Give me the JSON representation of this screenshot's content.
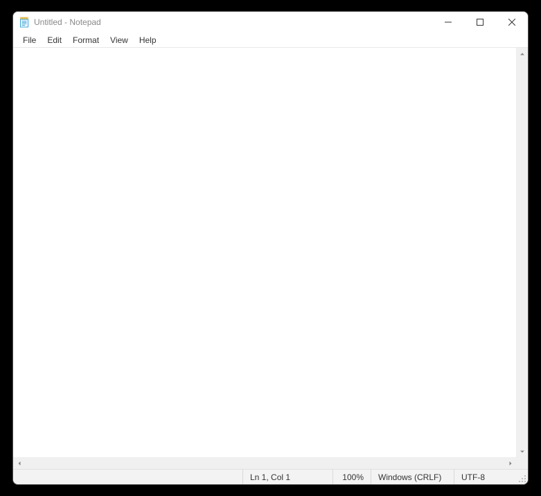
{
  "titlebar": {
    "title": "Untitled - Notepad"
  },
  "menu": {
    "file": "File",
    "edit": "Edit",
    "format": "Format",
    "view": "View",
    "help": "Help"
  },
  "editor": {
    "content": ""
  },
  "status": {
    "position": "Ln 1, Col 1",
    "zoom": "100%",
    "line_ending": "Windows (CRLF)",
    "encoding": "UTF-8"
  }
}
